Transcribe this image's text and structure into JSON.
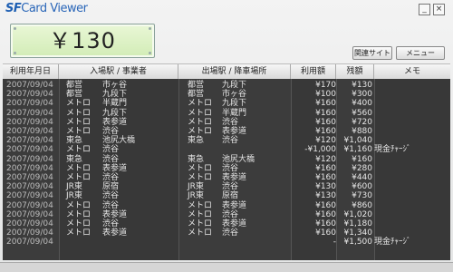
{
  "app": {
    "logo_prefix": "SF",
    "logo_rest": "Card Viewer"
  },
  "window_controls": {
    "minimize": "_",
    "close": "×"
  },
  "balance": {
    "display": "￥130"
  },
  "buttons": {
    "site": "関連サイト",
    "menu": "メニュー"
  },
  "table": {
    "headers": [
      "利用年月日",
      "入場駅 / 事業者",
      "出場駅 / 降車場所",
      "利用額",
      "残額",
      "メモ"
    ],
    "rows": [
      {
        "date": "2007/09/04",
        "in_op": "都営",
        "in_st": "市ヶ谷",
        "out_op": "都営",
        "out_st": "九段下",
        "amount": "¥170",
        "balance": "¥130",
        "memo": ""
      },
      {
        "date": "2007/09/04",
        "in_op": "都営",
        "in_st": "九段下",
        "out_op": "都営",
        "out_st": "市ヶ谷",
        "amount": "¥100",
        "balance": "¥300",
        "memo": ""
      },
      {
        "date": "2007/09/04",
        "in_op": "メトロ",
        "in_st": "半蔵門",
        "out_op": "メトロ",
        "out_st": "九段下",
        "amount": "¥160",
        "balance": "¥400",
        "memo": ""
      },
      {
        "date": "2007/09/04",
        "in_op": "メトロ",
        "in_st": "九段下",
        "out_op": "メトロ",
        "out_st": "半蔵門",
        "amount": "¥160",
        "balance": "¥560",
        "memo": ""
      },
      {
        "date": "2007/09/04",
        "in_op": "メトロ",
        "in_st": "表参道",
        "out_op": "メトロ",
        "out_st": "渋谷",
        "amount": "¥160",
        "balance": "¥720",
        "memo": ""
      },
      {
        "date": "2007/09/04",
        "in_op": "メトロ",
        "in_st": "渋谷",
        "out_op": "メトロ",
        "out_st": "表参道",
        "amount": "¥160",
        "balance": "¥880",
        "memo": ""
      },
      {
        "date": "2007/09/04",
        "in_op": "東急",
        "in_st": "池尻大橋",
        "out_op": "東急",
        "out_st": "渋谷",
        "amount": "¥120",
        "balance": "¥1,040",
        "memo": ""
      },
      {
        "date": "2007/09/04",
        "in_op": "メトロ",
        "in_st": "渋谷",
        "out_op": "",
        "out_st": "",
        "amount": "-¥1,000",
        "balance": "¥1,160",
        "memo": "現金ﾁｬｰｼﾞ"
      },
      {
        "date": "2007/09/04",
        "in_op": "東急",
        "in_st": "渋谷",
        "out_op": "東急",
        "out_st": "池尻大橋",
        "amount": "¥120",
        "balance": "¥160",
        "memo": ""
      },
      {
        "date": "2007/09/04",
        "in_op": "メトロ",
        "in_st": "表参道",
        "out_op": "メトロ",
        "out_st": "渋谷",
        "amount": "¥160",
        "balance": "¥280",
        "memo": ""
      },
      {
        "date": "2007/09/04",
        "in_op": "メトロ",
        "in_st": "渋谷",
        "out_op": "メトロ",
        "out_st": "表参道",
        "amount": "¥160",
        "balance": "¥440",
        "memo": ""
      },
      {
        "date": "2007/09/04",
        "in_op": "JR東",
        "in_st": "原宿",
        "out_op": "JR東",
        "out_st": "渋谷",
        "amount": "¥130",
        "balance": "¥600",
        "memo": ""
      },
      {
        "date": "2007/09/04",
        "in_op": "JR東",
        "in_st": "渋谷",
        "out_op": "JR東",
        "out_st": "原宿",
        "amount": "¥130",
        "balance": "¥730",
        "memo": ""
      },
      {
        "date": "2007/09/04",
        "in_op": "メトロ",
        "in_st": "渋谷",
        "out_op": "メトロ",
        "out_st": "表参道",
        "amount": "¥160",
        "balance": "¥860",
        "memo": ""
      },
      {
        "date": "2007/09/04",
        "in_op": "メトロ",
        "in_st": "表参道",
        "out_op": "メトロ",
        "out_st": "渋谷",
        "amount": "¥160",
        "balance": "¥1,020",
        "memo": ""
      },
      {
        "date": "2007/09/04",
        "in_op": "メトロ",
        "in_st": "渋谷",
        "out_op": "メトロ",
        "out_st": "表参道",
        "amount": "¥160",
        "balance": "¥1,180",
        "memo": ""
      },
      {
        "date": "2007/09/04",
        "in_op": "メトロ",
        "in_st": "表参道",
        "out_op": "メトロ",
        "out_st": "渋谷",
        "amount": "¥160",
        "balance": "¥1,340",
        "memo": ""
      },
      {
        "date": "2007/09/04",
        "in_op": "",
        "in_st": "",
        "out_op": "",
        "out_st": "",
        "amount": "-",
        "balance": "¥1,500",
        "memo": "現金ﾁｬｰｼﾞ"
      }
    ]
  }
}
